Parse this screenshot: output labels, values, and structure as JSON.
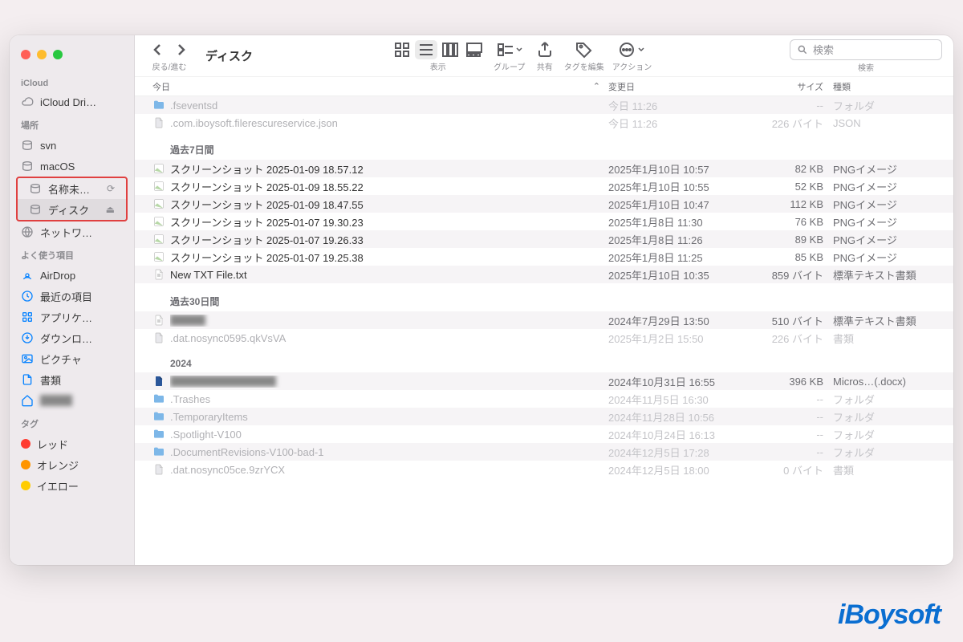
{
  "window": {
    "title": "ディスク",
    "nav_label": "戻る/進む"
  },
  "toolbar": {
    "view_label": "表示",
    "group_label": "グループ",
    "share_label": "共有",
    "tag_label": "タグを編集",
    "action_label": "アクション",
    "search_label": "検索",
    "search_placeholder": "検索"
  },
  "sidebar": {
    "sections": {
      "icloud": "iCloud",
      "locations": "場所",
      "favorites": "よく使う項目",
      "tags": "タグ"
    },
    "icloud_drive": "iCloud Dri…",
    "locations_items": [
      {
        "label": "svn"
      },
      {
        "label": "macOS"
      },
      {
        "label": "名称未…"
      },
      {
        "label": "ディスク"
      },
      {
        "label": "ネットワ…"
      }
    ],
    "favorites_items": [
      {
        "label": "AirDrop"
      },
      {
        "label": "最近の項目"
      },
      {
        "label": "アプリケ…"
      },
      {
        "label": "ダウンロ…"
      },
      {
        "label": "ピクチャ"
      },
      {
        "label": "書類"
      },
      {
        "label": "▪▪▪▪"
      }
    ],
    "tags_items": [
      {
        "label": "レッド",
        "color": "#ff3b30"
      },
      {
        "label": "オレンジ",
        "color": "#ff9500"
      },
      {
        "label": "イエロー",
        "color": "#ffcc00"
      }
    ]
  },
  "columns": {
    "name": "今日",
    "name_sort": "⌃",
    "date": "変更日",
    "size": "サイズ",
    "kind": "種類"
  },
  "groups": [
    {
      "label": "",
      "first": true,
      "rows": [
        {
          "name": ".fseventsd",
          "date": "今日 11:26",
          "size": "--",
          "kind": "フォルダ",
          "dim": true,
          "icon": "folder"
        },
        {
          "name": ".com.iboysoft.filerescureservice.json",
          "date": "今日 11:26",
          "size": "226 バイト",
          "kind": "JSON",
          "dim": true,
          "icon": "doc"
        }
      ]
    },
    {
      "label": "過去7日間",
      "rows": [
        {
          "name": "スクリーンショット 2025-01-09 18.57.12",
          "date": "2025年1月10日 10:57",
          "size": "82 KB",
          "kind": "PNGイメージ",
          "icon": "img"
        },
        {
          "name": "スクリーンショット 2025-01-09 18.55.22",
          "date": "2025年1月10日 10:55",
          "size": "52 KB",
          "kind": "PNGイメージ",
          "icon": "img"
        },
        {
          "name": "スクリーンショット 2025-01-09 18.47.55",
          "date": "2025年1月10日 10:47",
          "size": "112 KB",
          "kind": "PNGイメージ",
          "icon": "img"
        },
        {
          "name": "スクリーンショット 2025-01-07 19.30.23",
          "date": "2025年1月8日 11:30",
          "size": "76 KB",
          "kind": "PNGイメージ",
          "icon": "img"
        },
        {
          "name": "スクリーンショット 2025-01-07 19.26.33",
          "date": "2025年1月8日 11:26",
          "size": "89 KB",
          "kind": "PNGイメージ",
          "icon": "img"
        },
        {
          "name": "スクリーンショット 2025-01-07 19.25.38",
          "date": "2025年1月8日 11:25",
          "size": "85 KB",
          "kind": "PNGイメージ",
          "icon": "img"
        },
        {
          "name": "New TXT File.txt",
          "date": "2025年1月10日 10:35",
          "size": "859 バイト",
          "kind": "標準テキスト書類",
          "icon": "txt"
        }
      ]
    },
    {
      "label": "過去30日間",
      "rows": [
        {
          "name": "▪▪▪▪",
          "date": "2024年7月29日 13:50",
          "size": "510 バイト",
          "kind": "標準テキスト書類",
          "icon": "txt",
          "blur": true
        },
        {
          "name": ".dat.nosync0595.qkVsVA",
          "date": "2025年1月2日 15:50",
          "size": "226 バイト",
          "kind": "書類",
          "dim": true,
          "icon": "doc"
        }
      ]
    },
    {
      "label": "2024",
      "rows": [
        {
          "name": "▪▪▪▪▪▪▪▪▪▪▪▪",
          "date": "2024年10月31日 16:55",
          "size": "396 KB",
          "kind": "Micros…(.docx)",
          "icon": "docx",
          "blur": true
        },
        {
          "name": ".Trashes",
          "date": "2024年11月5日 16:30",
          "size": "--",
          "kind": "フォルダ",
          "dim": true,
          "icon": "folder"
        },
        {
          "name": ".TemporaryItems",
          "date": "2024年11月28日 10:56",
          "size": "--",
          "kind": "フォルダ",
          "dim": true,
          "icon": "folder"
        },
        {
          "name": ".Spotlight-V100",
          "date": "2024年10月24日 16:13",
          "size": "--",
          "kind": "フォルダ",
          "dim": true,
          "icon": "folder"
        },
        {
          "name": ".DocumentRevisions-V100-bad-1",
          "date": "2024年12月5日 17:28",
          "size": "--",
          "kind": "フォルダ",
          "dim": true,
          "icon": "folder"
        },
        {
          "name": ".dat.nosync05ce.9zrYCX",
          "date": "2024年12月5日 18:00",
          "size": "0 バイト",
          "kind": "書類",
          "dim": true,
          "icon": "doc"
        }
      ]
    }
  ],
  "watermark": "iBoysoft"
}
